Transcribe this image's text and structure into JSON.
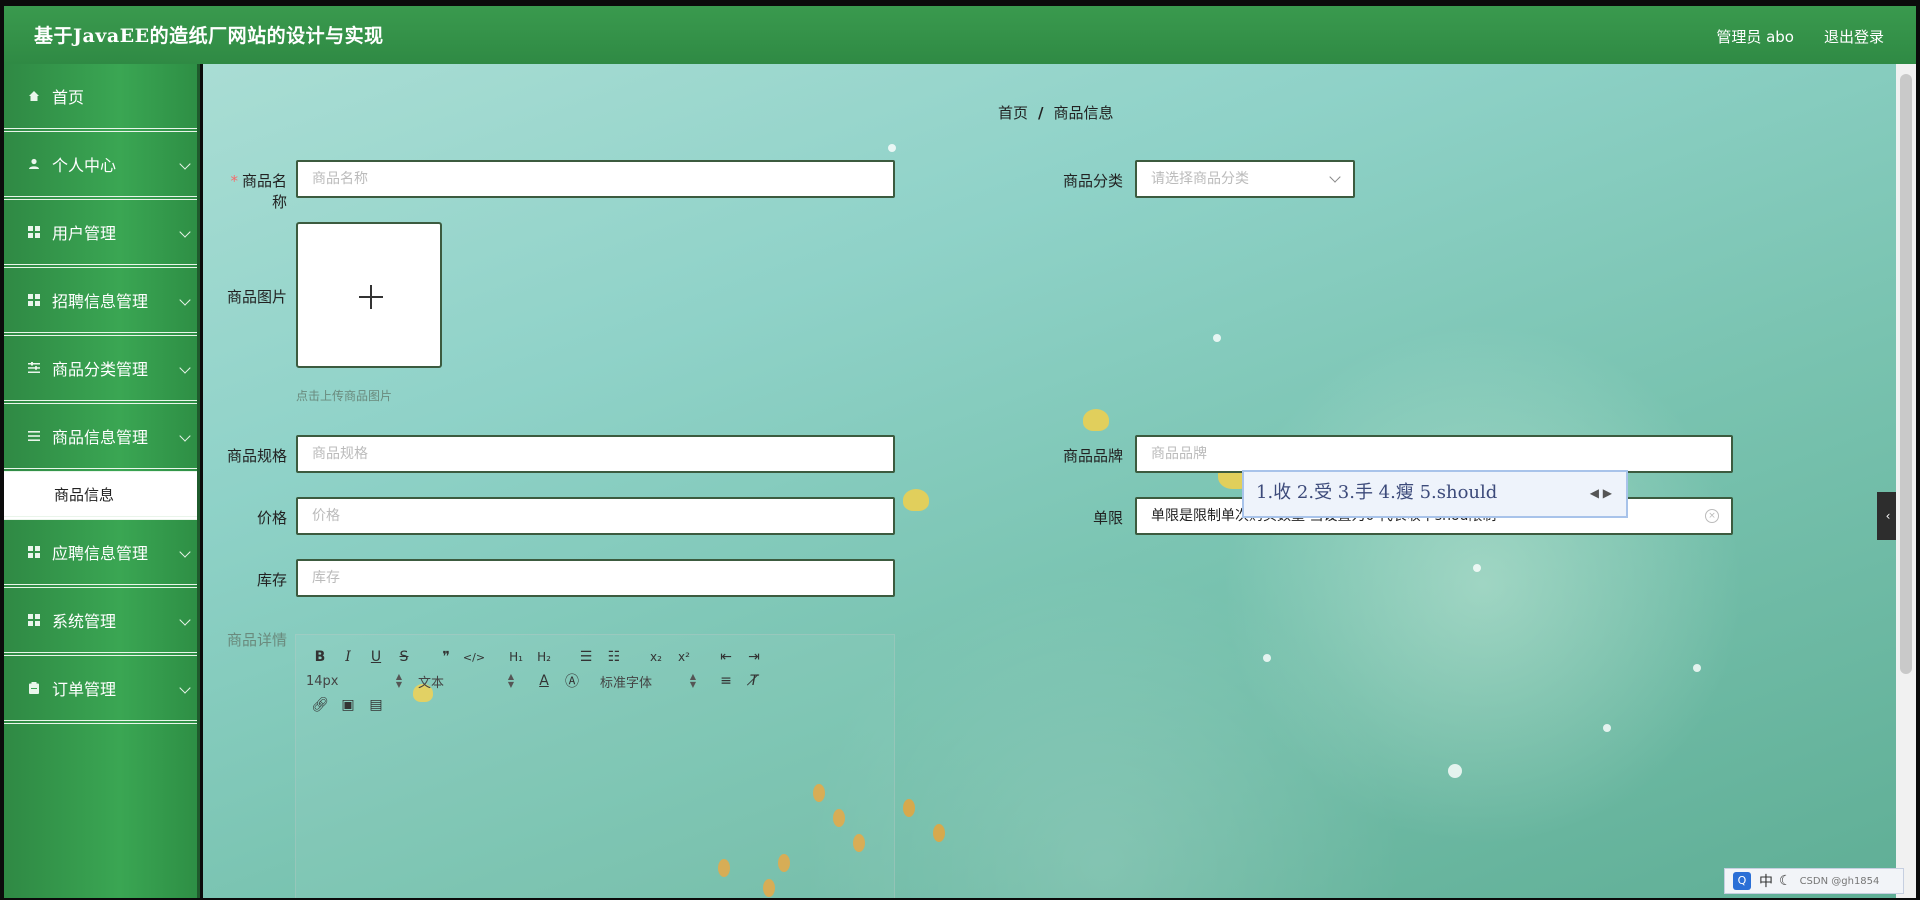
{
  "header": {
    "title": "基于JavaEE的造纸厂网站的设计与实现",
    "admin": "管理员 abo",
    "logout": "退出登录"
  },
  "sidebar": {
    "items": [
      {
        "label": "首页",
        "icon": "home-icon",
        "expandable": false
      },
      {
        "label": "个人中心",
        "icon": "user-icon",
        "expandable": true
      },
      {
        "label": "用户管理",
        "icon": "grid-icon",
        "expandable": true
      },
      {
        "label": "招聘信息管理",
        "icon": "grid-icon",
        "expandable": true
      },
      {
        "label": "商品分类管理",
        "icon": "sliders-icon",
        "expandable": true
      },
      {
        "label": "商品信息管理",
        "icon": "list-icon",
        "expandable": true
      },
      {
        "label": "应聘信息管理",
        "icon": "grid-icon",
        "expandable": true
      },
      {
        "label": "系统管理",
        "icon": "grid-icon",
        "expandable": true
      },
      {
        "label": "订单管理",
        "icon": "clipboard-icon",
        "expandable": true
      }
    ],
    "submenu": {
      "label": "商品信息"
    }
  },
  "breadcrumb": {
    "home": "首页",
    "separator": "/",
    "current": "商品信息"
  },
  "form": {
    "name": {
      "label": "商品名称",
      "placeholder": "商品名称",
      "required": true
    },
    "category": {
      "label": "商品分类",
      "placeholder": "请选择商品分类"
    },
    "image": {
      "label": "商品图片",
      "hint": "点击上传商品图片"
    },
    "spec": {
      "label": "商品规格",
      "placeholder": "商品规格"
    },
    "brand": {
      "label": "商品品牌",
      "placeholder": "商品品牌"
    },
    "price": {
      "label": "价格",
      "placeholder": "价格"
    },
    "limit": {
      "label": "单限",
      "value": "单限是限制单次购买数量 当设置为0 代表收不shou限制"
    },
    "stock": {
      "label": "库存",
      "placeholder": "库存"
    },
    "detail": {
      "label": "商品详情"
    }
  },
  "editor": {
    "font_size": "14px",
    "text_style": "文本",
    "font_family": "标准字体"
  },
  "ime": {
    "candidates": "1.收  2.受  3.手  4.瘦  5.should"
  },
  "tray": {
    "lang": "中",
    "watermark": "CSDN @gh1854"
  },
  "colors": {
    "header": "#2f8a44",
    "sidebar": "#3aa653",
    "input_border": "#3c5b3f",
    "required": "#f56c6c"
  }
}
